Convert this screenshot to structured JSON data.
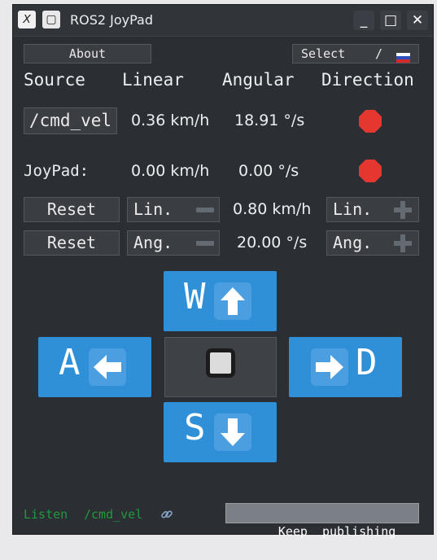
{
  "window": {
    "title": "ROS2 JoyPad",
    "icons": {
      "app": "x-logo-icon",
      "pin": "pin-icon"
    },
    "controls": {
      "minimize": "_",
      "maximize": "□",
      "close": "✕"
    }
  },
  "top": {
    "about": "About",
    "select_label": "Select",
    "slash": "/",
    "flag": "russian-flag-icon"
  },
  "headers": {
    "source": "Source",
    "linear": "Linear",
    "angular": "Angular",
    "direction": "Direction"
  },
  "rows": {
    "cmd_vel": {
      "source": "/cmd_vel",
      "linear": "0.36 km/h",
      "angular": "18.91 °/s",
      "direction_icon": "stop-sign-icon"
    },
    "joypad": {
      "source": "JoyPad:",
      "linear": "0.00 km/h",
      "angular": "0.00 °/s",
      "direction_icon": "stop-sign-icon"
    }
  },
  "limits": {
    "linear": {
      "reset": "Reset",
      "dec": "Lin.",
      "value": "0.80 km/h",
      "inc": "Lin."
    },
    "angular": {
      "reset": "Reset",
      "dec": "Ang.",
      "value": "20.00 °/s",
      "inc": "Ang."
    }
  },
  "keys": {
    "up": "W",
    "left": "A",
    "right": "D",
    "down": "S"
  },
  "footer": {
    "listen": "Listen",
    "topic": "/cmd_vel",
    "link_icon": "link-icon",
    "keep": "Keep  publishing"
  },
  "colors": {
    "accent": "#2f8fd7",
    "stop": "#e5372f",
    "listen_green": "#1f9a3c"
  }
}
